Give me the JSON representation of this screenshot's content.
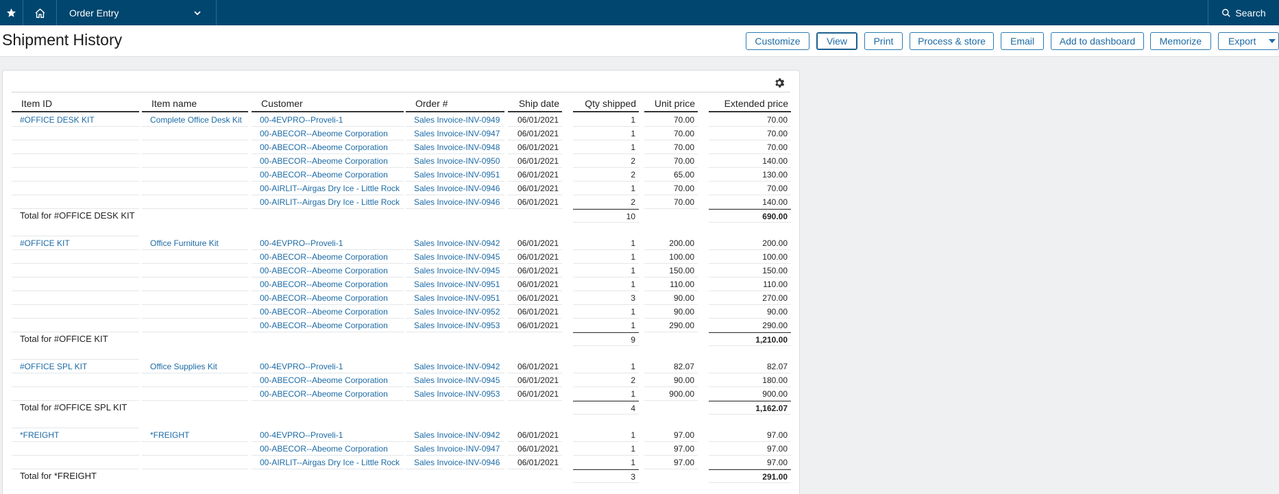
{
  "topbar": {
    "app_name": "Order Entry",
    "search_label": "Search"
  },
  "page": {
    "title": "Shipment History"
  },
  "toolbar": {
    "buttons": [
      {
        "label": "Customize"
      },
      {
        "label": "View"
      },
      {
        "label": "Print"
      },
      {
        "label": "Process & store"
      },
      {
        "label": "Email"
      },
      {
        "label": "Add to dashboard"
      },
      {
        "label": "Memorize"
      },
      {
        "label": "Export"
      }
    ]
  },
  "colors": {
    "topbar": "#00466f",
    "link": "#1b6aa5",
    "button_border": "#2a7ab0"
  },
  "report": {
    "columns": [
      "Item ID",
      "Item name",
      "Customer",
      "Order #",
      "Ship date",
      "Qty shipped",
      "Unit price",
      "Extended price"
    ],
    "groups": [
      {
        "item_id": "#OFFICE DESK KIT",
        "item_name": "Complete Office Desk Kit",
        "rows": [
          {
            "customer": "00-4EVPRO--Proveli-1",
            "order": "Sales Invoice-INV-0949",
            "date": "06/01/2021",
            "qty": "1",
            "unit": "70.00",
            "ext": "70.00"
          },
          {
            "customer": "00-ABECOR--Abeome Corporation",
            "order": "Sales Invoice-INV-0947",
            "date": "06/01/2021",
            "qty": "1",
            "unit": "70.00",
            "ext": "70.00"
          },
          {
            "customer": "00-ABECOR--Abeome Corporation",
            "order": "Sales Invoice-INV-0948",
            "date": "06/01/2021",
            "qty": "1",
            "unit": "70.00",
            "ext": "70.00"
          },
          {
            "customer": "00-ABECOR--Abeome Corporation",
            "order": "Sales Invoice-INV-0950",
            "date": "06/01/2021",
            "qty": "2",
            "unit": "70.00",
            "ext": "140.00"
          },
          {
            "customer": "00-ABECOR--Abeome Corporation",
            "order": "Sales Invoice-INV-0951",
            "date": "06/01/2021",
            "qty": "2",
            "unit": "65.00",
            "ext": "130.00"
          },
          {
            "customer": "00-AIRLIT--Airgas Dry Ice - Little Rock",
            "order": "Sales Invoice-INV-0946",
            "date": "06/01/2021",
            "qty": "1",
            "unit": "70.00",
            "ext": "70.00"
          },
          {
            "customer": "00-AIRLIT--Airgas Dry Ice - Little Rock",
            "order": "Sales Invoice-INV-0946",
            "date": "06/01/2021",
            "qty": "2",
            "unit": "70.00",
            "ext": "140.00"
          }
        ],
        "total_label": "Total for #OFFICE DESK KIT",
        "total_qty": "10",
        "total_ext": "690.00"
      },
      {
        "item_id": "#OFFICE KIT",
        "item_name": "Office Furniture Kit",
        "rows": [
          {
            "customer": "00-4EVPRO--Proveli-1",
            "order": "Sales Invoice-INV-0942",
            "date": "06/01/2021",
            "qty": "1",
            "unit": "200.00",
            "ext": "200.00"
          },
          {
            "customer": "00-ABECOR--Abeome Corporation",
            "order": "Sales Invoice-INV-0945",
            "date": "06/01/2021",
            "qty": "1",
            "unit": "100.00",
            "ext": "100.00"
          },
          {
            "customer": "00-ABECOR--Abeome Corporation",
            "order": "Sales Invoice-INV-0945",
            "date": "06/01/2021",
            "qty": "1",
            "unit": "150.00",
            "ext": "150.00"
          },
          {
            "customer": "00-ABECOR--Abeome Corporation",
            "order": "Sales Invoice-INV-0951",
            "date": "06/01/2021",
            "qty": "1",
            "unit": "110.00",
            "ext": "110.00"
          },
          {
            "customer": "00-ABECOR--Abeome Corporation",
            "order": "Sales Invoice-INV-0951",
            "date": "06/01/2021",
            "qty": "3",
            "unit": "90.00",
            "ext": "270.00"
          },
          {
            "customer": "00-ABECOR--Abeome Corporation",
            "order": "Sales Invoice-INV-0952",
            "date": "06/01/2021",
            "qty": "1",
            "unit": "90.00",
            "ext": "90.00"
          },
          {
            "customer": "00-ABECOR--Abeome Corporation",
            "order": "Sales Invoice-INV-0953",
            "date": "06/01/2021",
            "qty": "1",
            "unit": "290.00",
            "ext": "290.00"
          }
        ],
        "total_label": "Total for #OFFICE KIT",
        "total_qty": "9",
        "total_ext": "1,210.00"
      },
      {
        "item_id": "#OFFICE SPL KIT",
        "item_name": "Office Supplies Kit",
        "rows": [
          {
            "customer": "00-4EVPRO--Proveli-1",
            "order": "Sales Invoice-INV-0942",
            "date": "06/01/2021",
            "qty": "1",
            "unit": "82.07",
            "ext": "82.07"
          },
          {
            "customer": "00-ABECOR--Abeome Corporation",
            "order": "Sales Invoice-INV-0945",
            "date": "06/01/2021",
            "qty": "2",
            "unit": "90.00",
            "ext": "180.00"
          },
          {
            "customer": "00-ABECOR--Abeome Corporation",
            "order": "Sales Invoice-INV-0953",
            "date": "06/01/2021",
            "qty": "1",
            "unit": "900.00",
            "ext": "900.00"
          }
        ],
        "total_label": "Total for #OFFICE SPL KIT",
        "total_qty": "4",
        "total_ext": "1,162.07"
      },
      {
        "item_id": "*FREIGHT",
        "item_name": "*FREIGHT",
        "rows": [
          {
            "customer": "00-4EVPRO--Proveli-1",
            "order": "Sales Invoice-INV-0942",
            "date": "06/01/2021",
            "qty": "1",
            "unit": "97.00",
            "ext": "97.00"
          },
          {
            "customer": "00-ABECOR--Abeome Corporation",
            "order": "Sales Invoice-INV-0947",
            "date": "06/01/2021",
            "qty": "1",
            "unit": "97.00",
            "ext": "97.00"
          },
          {
            "customer": "00-AIRLIT--Airgas Dry Ice - Little Rock",
            "order": "Sales Invoice-INV-0946",
            "date": "06/01/2021",
            "qty": "1",
            "unit": "97.00",
            "ext": "97.00"
          }
        ],
        "total_label": "Total for *FREIGHT",
        "total_qty": "3",
        "total_ext": "291.00"
      }
    ]
  }
}
